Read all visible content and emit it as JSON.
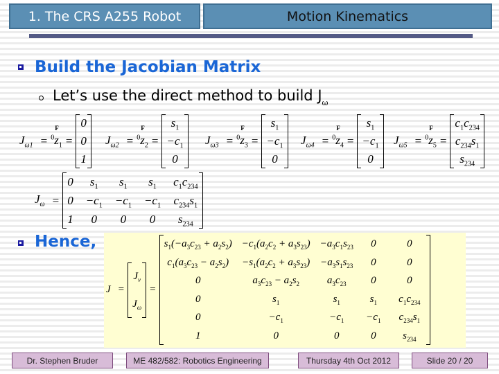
{
  "header": {
    "section": "1. The CRS A255 Robot",
    "topic": "Motion Kinematics"
  },
  "bullets": {
    "build": "Build the Jacobian Matrix",
    "direct_method": "Let’s use the direct method to build J",
    "direct_method_sub": "ω",
    "hence": "Hence,"
  },
  "equations": {
    "jw_columns": [
      {
        "lhs": "J",
        "lhs_sub": "ω1",
        "z": "z",
        "z_sub": "1",
        "values": [
          "0",
          "0",
          "1"
        ]
      },
      {
        "lhs": "J",
        "lhs_sub": "ω2",
        "z": "z",
        "z_sub": "2",
        "values": [
          "s1",
          "−c1",
          "0"
        ]
      },
      {
        "lhs": "J",
        "lhs_sub": "ω3",
        "z": "z",
        "z_sub": "3",
        "values": [
          "s1",
          "−c1",
          "0"
        ]
      },
      {
        "lhs": "J",
        "lhs_sub": "ω4",
        "z": "z",
        "z_sub": "4",
        "values": [
          "s1",
          "−c1",
          "0"
        ]
      },
      {
        "lhs": "J",
        "lhs_sub": "ω5",
        "z": "z",
        "z_sub": "5",
        "values": [
          "c1c234",
          "c234s1",
          "s234"
        ]
      }
    ],
    "frame_sup": "0",
    "frame_mark": "F",
    "equals": "=",
    "jw_full": {
      "lhs": "J",
      "lhs_sub": "ω",
      "rows": [
        [
          "0",
          "s1",
          "s1",
          "s1",
          "c1c234"
        ],
        [
          "0",
          "−c1",
          "−c1",
          "−c1",
          "c234s1"
        ],
        [
          "1",
          "0",
          "0",
          "0",
          "s234"
        ]
      ]
    },
    "full_jacobian": {
      "lhs": "J",
      "stack": [
        "Jv",
        "Jω"
      ],
      "rows": [
        [
          "s1(−a3c23 + a2s2)",
          "−c1(a2c2 + a3s23)",
          "−a3c1s23",
          "0",
          "0"
        ],
        [
          "c1(a3c23 − a2s2)",
          "−s1(a2c2 + a3s23)",
          "−a3s1s23",
          "0",
          "0"
        ],
        [
          "0",
          "a3c23 − a2s2",
          "a3c23",
          "0",
          "0"
        ],
        [
          "0",
          "s1",
          "s1",
          "s1",
          "c1c234"
        ],
        [
          "0",
          "−c1",
          "−c1",
          "−c1",
          "c234s1"
        ],
        [
          "1",
          "0",
          "0",
          "0",
          "s234"
        ]
      ]
    }
  },
  "footer": {
    "author": "Dr. Stephen Bruder",
    "course": "ME 482/582: Robotics Engineering",
    "date": "Thursday 4th Oct 2012",
    "slide": "Slide 20 /  20"
  },
  "colors": {
    "header_bg": "#5b8fb4",
    "rule": "#545a85",
    "heading": "#1a66d6",
    "footer_bg": "#d8bcd8",
    "highlight_bg": "#fffed2"
  }
}
